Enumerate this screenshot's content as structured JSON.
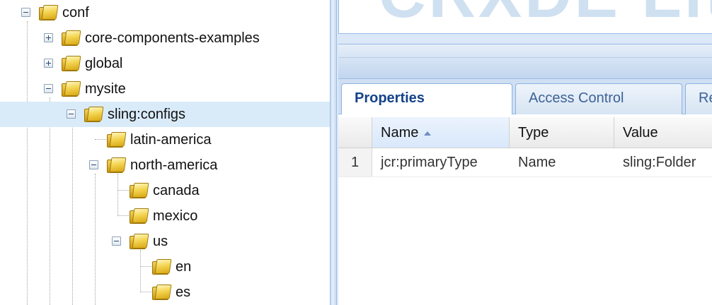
{
  "tree": {
    "nodes": [
      {
        "label": "conf",
        "toggle": "minus"
      },
      {
        "label": "core-components-examples",
        "toggle": "plus"
      },
      {
        "label": "global",
        "toggle": "plus"
      },
      {
        "label": "mysite",
        "toggle": "minus"
      },
      {
        "label": "sling:configs",
        "toggle": "minus",
        "selected": true
      },
      {
        "label": "latin-america",
        "toggle": "none"
      },
      {
        "label": "north-america",
        "toggle": "minus"
      },
      {
        "label": "canada",
        "toggle": "none"
      },
      {
        "label": "mexico",
        "toggle": "none"
      },
      {
        "label": "us",
        "toggle": "minus"
      },
      {
        "label": "en",
        "toggle": "none"
      },
      {
        "label": "es",
        "toggle": "none"
      }
    ]
  },
  "header": {
    "logo_text": "CRXDE Lite"
  },
  "tabs": [
    {
      "label": "Properties",
      "active": true
    },
    {
      "label": "Access Control",
      "active": false
    },
    {
      "label": "Replication",
      "active": false
    }
  ],
  "grid": {
    "columns": [
      "Name",
      "Type",
      "Value"
    ],
    "sorted_column": "Name",
    "rows": [
      {
        "num": "1",
        "name": "jcr:primaryType",
        "type": "Name",
        "value": "sling:Folder"
      }
    ]
  },
  "colors": {
    "selection": "#d9ebf9",
    "accent": "#15428b"
  }
}
